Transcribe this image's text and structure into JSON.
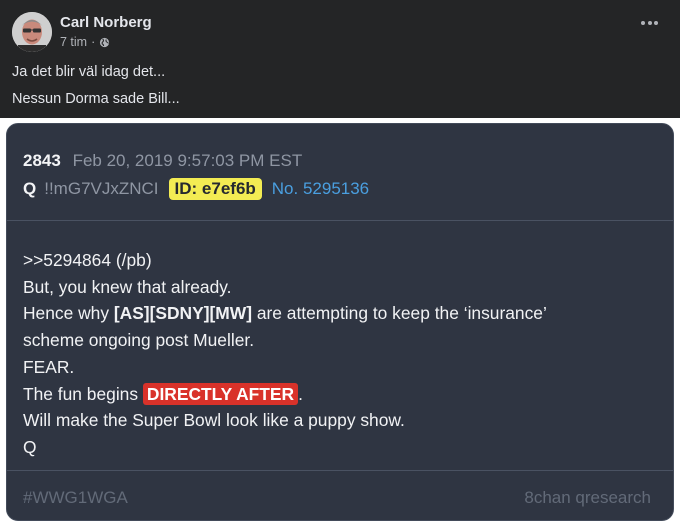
{
  "facebook_post": {
    "author": "Carl Norberg",
    "time": "7 tim",
    "separator": "·",
    "privacy_icon": "globe-icon",
    "more_icon": "more-options-icon",
    "text_lines": [
      "Ja det blir väl idag det...",
      "Nessun Dorma sade Bill..."
    ]
  },
  "q_post": {
    "post_number": "2843",
    "timestamp": "Feb 20, 2019 9:57:03 PM EST",
    "name": "Q",
    "tripcode": "!!mG7VJxZNCI",
    "id_label": "ID: e7ef6b",
    "post_no": "No. 5295136",
    "body": {
      "line1": ">>5294864 (/pb)",
      "line2": "But, you knew that already.",
      "line3_pre": "Hence why ",
      "line3_bold": "[AS][SDNY][MW]",
      "line3_post": " are attempting to keep the ‘insurance’",
      "line4": "scheme ongoing post Mueller.",
      "line5": "FEAR.",
      "line6_pre": "The fun begins ",
      "line6_highlight": "DIRECTLY AFTER",
      "line6_post": ".",
      "line7": "Will make the Super Bowl look like a puppy show.",
      "line8": "Q"
    },
    "footer": {
      "hashtag": "#WWG1WGA",
      "source": "8chan qresearch"
    },
    "colors": {
      "card_bg": "#2f3542",
      "id_badge": "#f3ec53",
      "highlight": "#d9322a",
      "post_link": "#4a9fe0"
    }
  }
}
